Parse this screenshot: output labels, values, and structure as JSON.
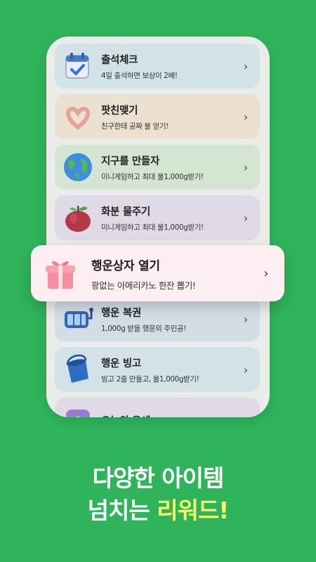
{
  "colors": {
    "background": "#2fb45c",
    "accent_text": "#f5f56a"
  },
  "cards": [
    {
      "title": "출석체크",
      "subtitle": "4일 출석하면 보상이 2배!",
      "icon": "calendar-check-icon",
      "color": "#d3e2e6"
    },
    {
      "title": "팟친맺기",
      "subtitle": "친구한테 공짜 물 얻기!",
      "icon": "heart-hands-icon",
      "color": "#ece0d1"
    },
    {
      "title": "지구를 만들자",
      "subtitle": "미니게임하고 최대 물1,000g받기!",
      "icon": "earth-globe-icon",
      "color": "#d4e6d2"
    },
    {
      "title": "화분 물주기",
      "subtitle": "미니게임하고 최대 물1,000g받기!",
      "icon": "apple-icon",
      "color": "#dfdae6"
    },
    {
      "title": "행운 복권",
      "subtitle": "1,000g 받을 행운의 주인공!",
      "icon": "slot-machine-icon",
      "color": "#d3dde6"
    },
    {
      "title": "행운 빙고",
      "subtitle": "빙고 2줄 만들고, 물1,000g받기!",
      "icon": "water-bucket-icon",
      "color": "#d3e2e6"
    },
    {
      "title": "오늘의 운세",
      "subtitle": "",
      "icon": "fortune-icon",
      "color": "#dfdae6"
    }
  ],
  "highlight": {
    "title": "행운상자 열기",
    "subtitle": "꽝없는 아메리카노 한잔 뽑기!",
    "icon": "gift-box-icon"
  },
  "chevron": "›",
  "headline": {
    "line1": "다양한 아이템",
    "line2_prefix": "넘치는 ",
    "line2_highlight": "리워드!"
  }
}
